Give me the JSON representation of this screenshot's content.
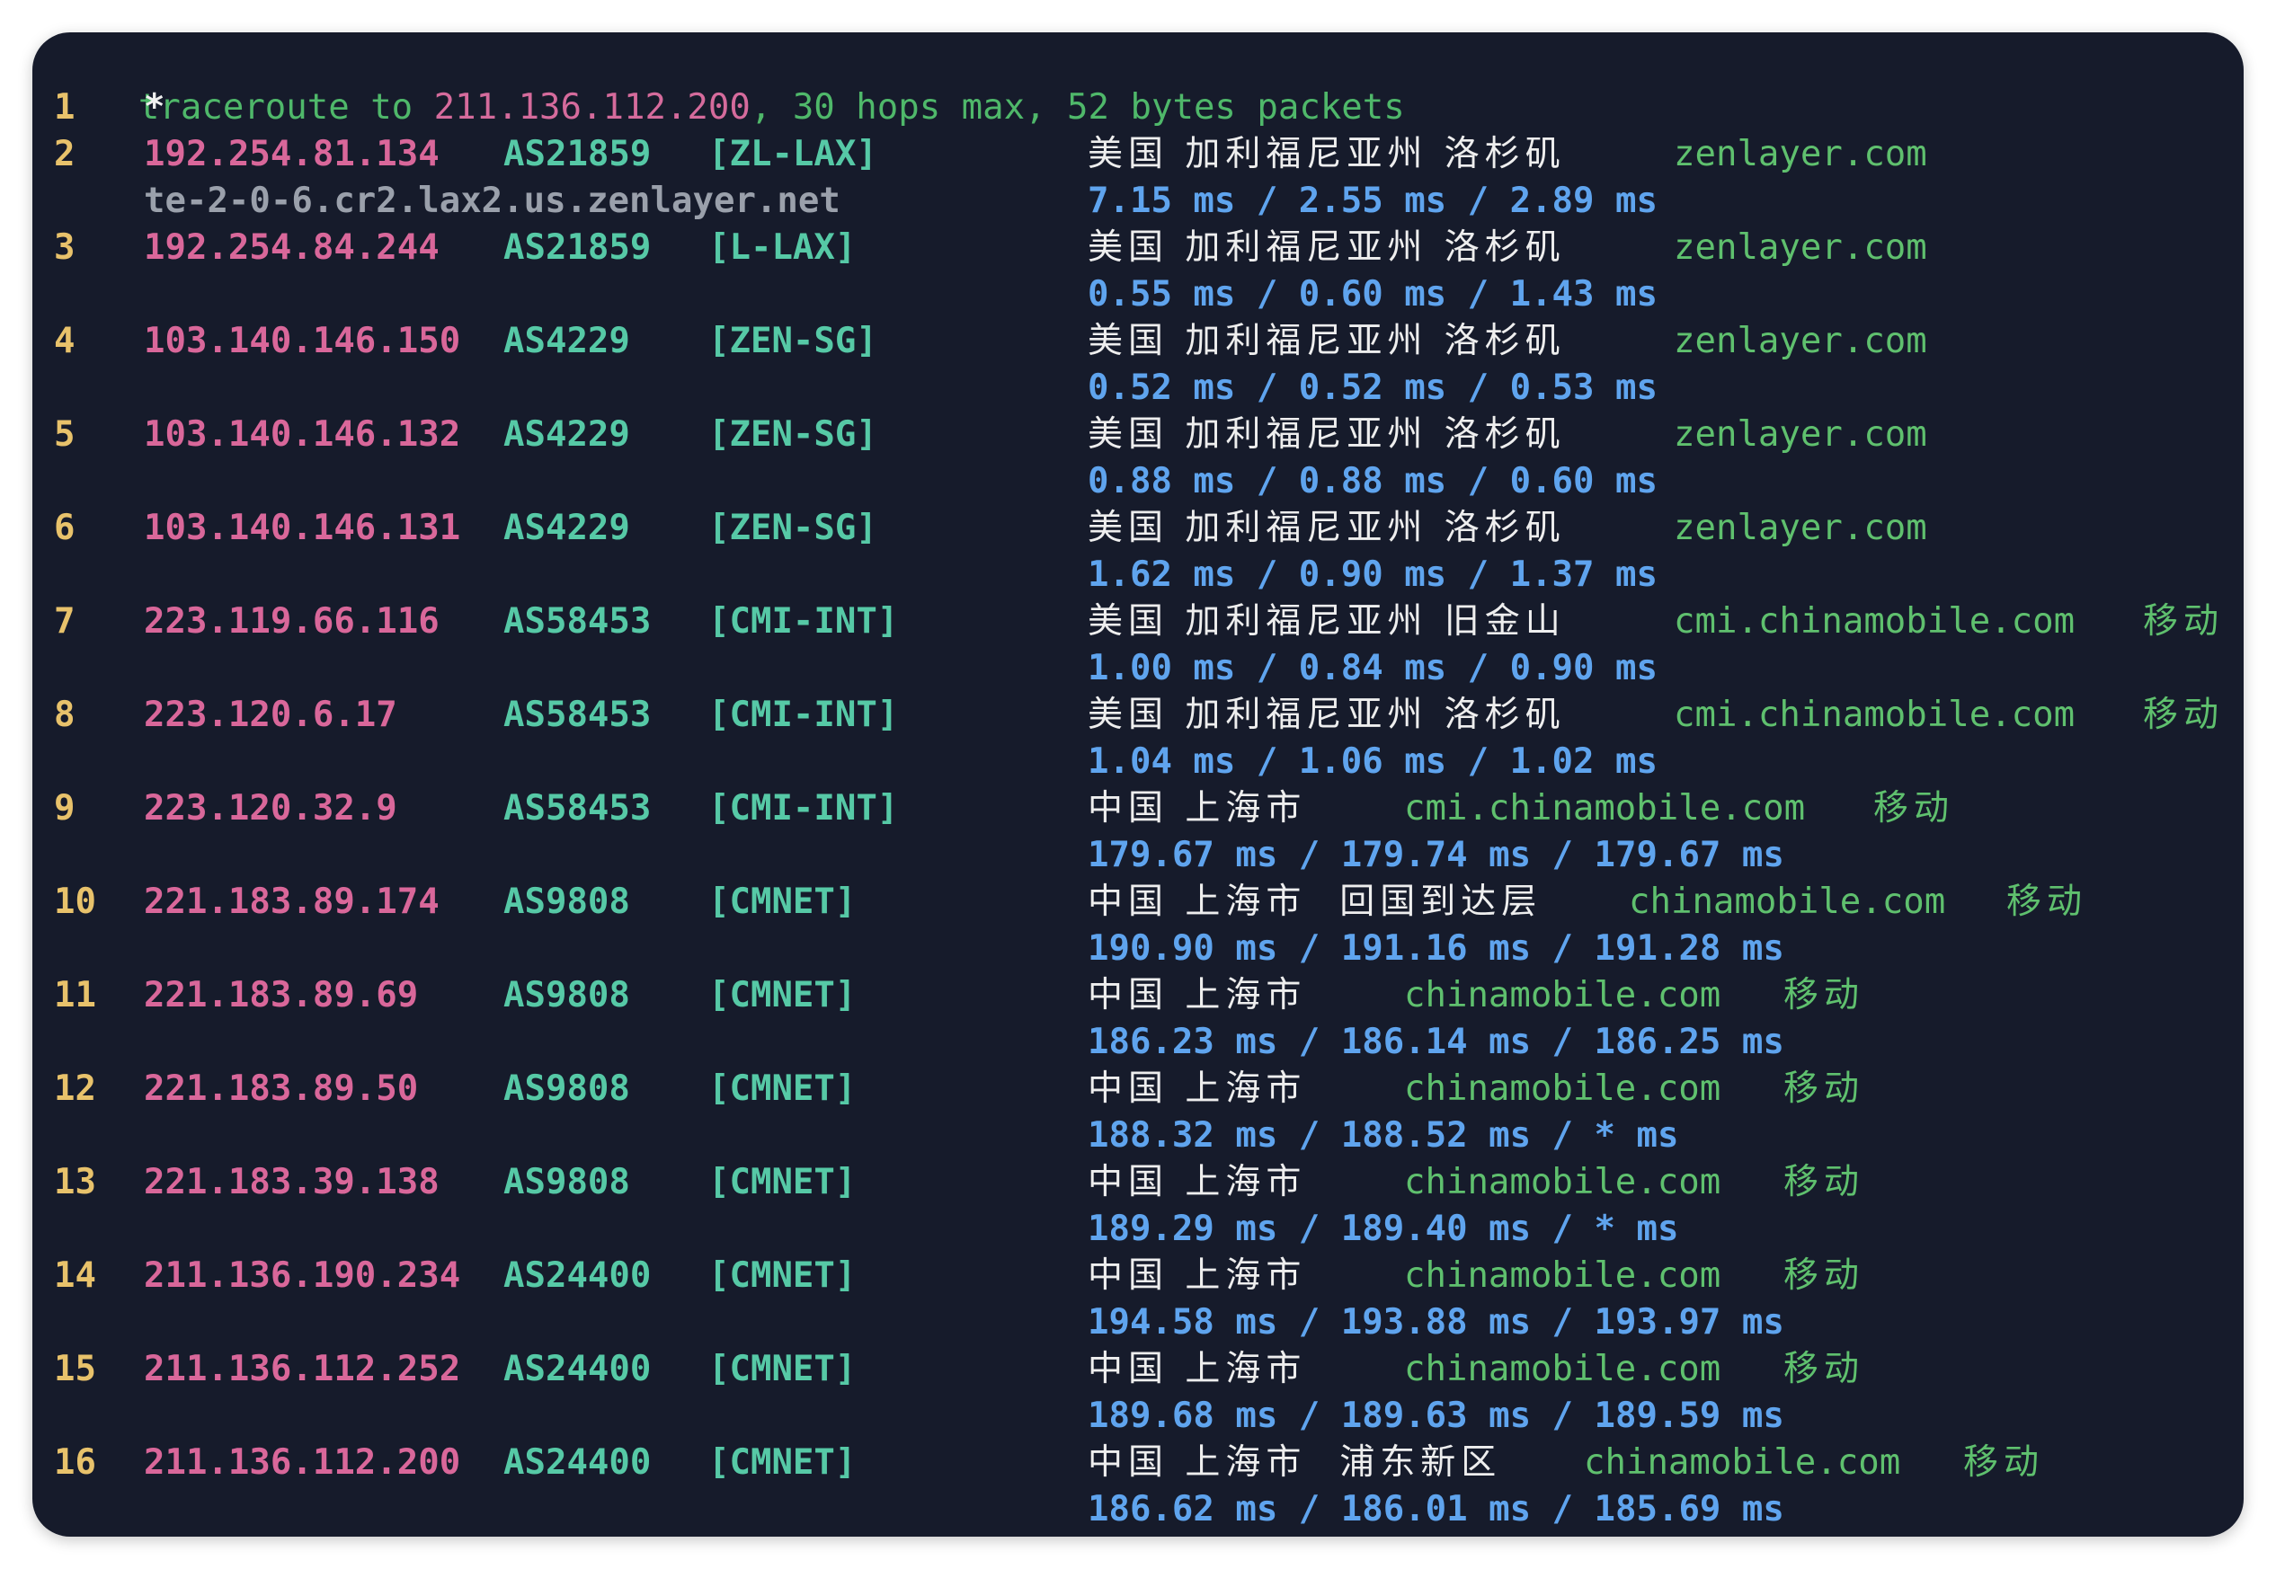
{
  "header": {
    "prefix": "traceroute to ",
    "target": "211.136.112.200",
    "suffix": ", 30 hops max, 52 bytes packets"
  },
  "hops": [
    {
      "hop": "1",
      "star": "*"
    },
    {
      "hop": "2",
      "ip": "192.254.81.134",
      "as": "AS21859",
      "tag": "[ZL-LAX]",
      "geo": "美国 加利福尼亚州 洛杉矶",
      "domain": "zenlayer.com",
      "isp": "",
      "rdns": "te-2-0-6.cr2.lax2.us.zenlayer.net",
      "latency": "7.15 ms / 2.55 ms / 2.89 ms"
    },
    {
      "hop": "3",
      "ip": "192.254.84.244",
      "as": "AS21859",
      "tag": "[L-LAX]",
      "geo": "美国 加利福尼亚州 洛杉矶",
      "domain": "zenlayer.com",
      "isp": "",
      "latency": "0.55 ms / 0.60 ms / 1.43 ms"
    },
    {
      "hop": "4",
      "ip": "103.140.146.150",
      "as": "AS4229",
      "tag": "[ZEN-SG]",
      "geo": "美国 加利福尼亚州 洛杉矶",
      "domain": "zenlayer.com",
      "isp": "",
      "latency": "0.52 ms / 0.52 ms / 0.53 ms"
    },
    {
      "hop": "5",
      "ip": "103.140.146.132",
      "as": "AS4229",
      "tag": "[ZEN-SG]",
      "geo": "美国 加利福尼亚州 洛杉矶",
      "domain": "zenlayer.com",
      "isp": "",
      "latency": "0.88 ms / 0.88 ms / 0.60 ms"
    },
    {
      "hop": "6",
      "ip": "103.140.146.131",
      "as": "AS4229",
      "tag": "[ZEN-SG]",
      "geo": "美国 加利福尼亚州 洛杉矶",
      "domain": "zenlayer.com",
      "isp": "",
      "latency": "1.62 ms / 0.90 ms / 1.37 ms"
    },
    {
      "hop": "7",
      "ip": "223.119.66.116",
      "as": "AS58453",
      "tag": "[CMI-INT]",
      "geo": "美国 加利福尼亚州 旧金山",
      "domain": "cmi.chinamobile.com",
      "isp": "移动",
      "latency": "1.00 ms / 0.84 ms / 0.90 ms"
    },
    {
      "hop": "8",
      "ip": "223.120.6.17",
      "as": "AS58453",
      "tag": "[CMI-INT]",
      "geo": "美国 加利福尼亚州 洛杉矶",
      "domain": "cmi.chinamobile.com",
      "isp": "移动",
      "latency": "1.04 ms / 1.06 ms / 1.02 ms"
    },
    {
      "hop": "9",
      "ip": "223.120.32.9",
      "as": "AS58453",
      "tag": "[CMI-INT]",
      "geo": "中国 上海市",
      "domain": "cmi.chinamobile.com",
      "isp": "移动",
      "latency": "179.67 ms / 179.74 ms / 179.67 ms"
    },
    {
      "hop": "10",
      "ip": "221.183.89.174",
      "as": "AS9808",
      "tag": "[CMNET]",
      "geo": "中国 上海市  回国到达层",
      "domain": "chinamobile.com",
      "isp": "移动",
      "latency": "190.90 ms / 191.16 ms / 191.28 ms"
    },
    {
      "hop": "11",
      "ip": "221.183.89.69",
      "as": "AS9808",
      "tag": "[CMNET]",
      "geo": "中国 上海市",
      "domain": "chinamobile.com",
      "isp": "移动",
      "latency": "186.23 ms / 186.14 ms / 186.25 ms"
    },
    {
      "hop": "12",
      "ip": "221.183.89.50",
      "as": "AS9808",
      "tag": "[CMNET]",
      "geo": "中国 上海市",
      "domain": "chinamobile.com",
      "isp": "移动",
      "latency": "188.32 ms / 188.52 ms / * ms"
    },
    {
      "hop": "13",
      "ip": "221.183.39.138",
      "as": "AS9808",
      "tag": "[CMNET]",
      "geo": "中国 上海市",
      "domain": "chinamobile.com",
      "isp": "移动",
      "latency": "189.29 ms / 189.40 ms / * ms"
    },
    {
      "hop": "14",
      "ip": "211.136.190.234",
      "as": "AS24400",
      "tag": "[CMNET]",
      "geo": "中国 上海市",
      "domain": "chinamobile.com",
      "isp": "移动",
      "latency": "194.58 ms / 193.88 ms / 193.97 ms"
    },
    {
      "hop": "15",
      "ip": "211.136.112.252",
      "as": "AS24400",
      "tag": "[CMNET]",
      "geo": "中国 上海市",
      "domain": "chinamobile.com",
      "isp": "移动",
      "latency": "189.68 ms / 189.63 ms / 189.59 ms"
    },
    {
      "hop": "16",
      "ip": "211.136.112.200",
      "as": "AS24400",
      "tag": "[CMNET]",
      "geo": "中国 上海市  浦东新区",
      "domain": "chinamobile.com",
      "isp": "移动",
      "latency": "186.62 ms / 186.01 ms / 185.69 ms"
    }
  ]
}
